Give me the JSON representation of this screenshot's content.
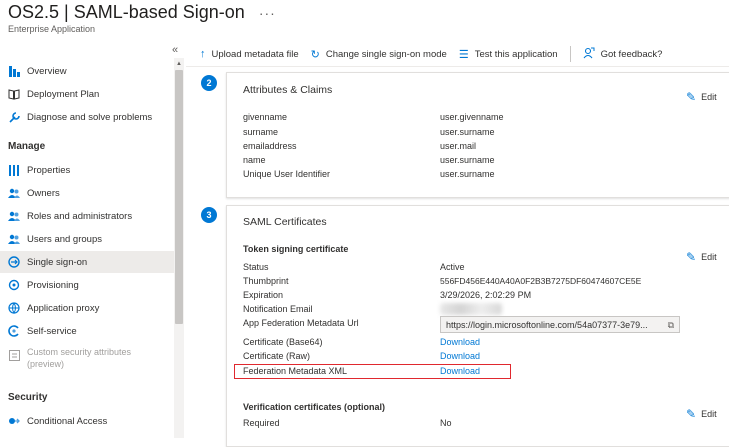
{
  "header": {
    "title": "OS2.5 | SAML-based Sign-on",
    "more": "···",
    "subtitle": "Enterprise Application"
  },
  "sidebar": {
    "collapse": "«",
    "items": [
      {
        "label": "Overview",
        "icon": "grid-icon"
      },
      {
        "label": "Deployment Plan",
        "icon": "book-icon"
      },
      {
        "label": "Diagnose and solve problems",
        "icon": "wrench-icon"
      }
    ],
    "manage_header": "Manage",
    "manage_items": [
      {
        "label": "Properties",
        "icon": "properties-icon"
      },
      {
        "label": "Owners",
        "icon": "people-icon"
      },
      {
        "label": "Roles and administrators",
        "icon": "people-icon"
      },
      {
        "label": "Users and groups",
        "icon": "people-icon"
      },
      {
        "label": "Single sign-on",
        "icon": "sso-icon",
        "selected": true
      },
      {
        "label": "Provisioning",
        "icon": "provisioning-icon"
      },
      {
        "label": "Application proxy",
        "icon": "proxy-icon"
      },
      {
        "label": "Self-service",
        "icon": "self-service-icon"
      },
      {
        "label": "Custom security attributes (preview)",
        "icon": "attributes-icon",
        "disabled": true
      }
    ],
    "security_header": "Security",
    "security_items": [
      {
        "label": "Conditional Access",
        "icon": "conditional-access-icon"
      }
    ]
  },
  "toolbar": {
    "upload": "Upload metadata file",
    "change_mode": "Change single sign-on mode",
    "test": "Test this application",
    "feedback": "Got feedback?"
  },
  "attributes": {
    "step": "2",
    "title": "Attributes & Claims",
    "edit": "Edit",
    "rows": [
      {
        "name": "givenname",
        "value": "user.givenname"
      },
      {
        "name": "surname",
        "value": "user.surname"
      },
      {
        "name": "emailaddress",
        "value": "user.mail"
      },
      {
        "name": "name",
        "value": "user.surname"
      },
      {
        "name": "Unique User Identifier",
        "value": "user.surname"
      }
    ]
  },
  "certificates": {
    "step": "3",
    "title": "SAML Certificates",
    "token_header": "Token signing certificate",
    "edit": "Edit",
    "status_label": "Status",
    "status_value": "Active",
    "thumbprint_label": "Thumbprint",
    "thumbprint_value": "556FD456E440A40A0F2B3B7275DF60474607CE5E",
    "expiration_label": "Expiration",
    "expiration_value": "3/29/2026, 2:02:29 PM",
    "notification_label": "Notification Email",
    "metadata_url_label": "App Federation Metadata Url",
    "metadata_url_value": "https://login.microsoftonline.com/54a07377-3e79...",
    "base64_label": "Certificate (Base64)",
    "base64_link": "Download",
    "raw_label": "Certificate (Raw)",
    "raw_link": "Download",
    "fedxml_label": "Federation Metadata XML",
    "fedxml_link": "Download",
    "verification_header": "Verification certificates (optional)",
    "verification_edit": "Edit",
    "required_label": "Required",
    "required_value": "No"
  },
  "colors": {
    "accent": "#0078d4",
    "highlight": "#e0282e"
  }
}
